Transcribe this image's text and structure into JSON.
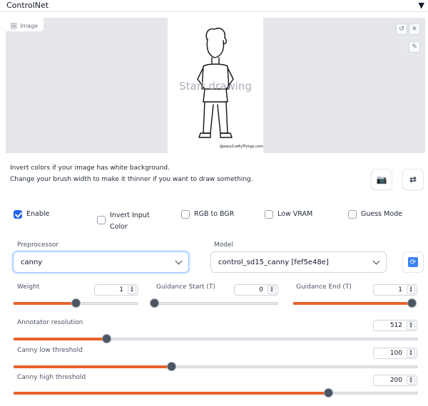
{
  "header": {
    "title": "ControlNet",
    "collapse_icon": "▼"
  },
  "canvas": {
    "image_tag": "Image",
    "placeholder": "Start drawing",
    "watermark": "@easyCraftyThings.com",
    "icons": [
      "undo-icon",
      "brush-icon"
    ]
  },
  "info": {
    "line1": "Invert colors if your image has white background.",
    "line2": "Change your brush width to make it thinner if you want to draw something.",
    "camera_icon": "📷",
    "swap_icon": "⇄"
  },
  "checkboxes": [
    {
      "label": "Enable",
      "checked": true
    },
    {
      "label": "Invert Input Color",
      "checked": false
    },
    {
      "label": "RGB to BGR",
      "checked": false
    },
    {
      "label": "Low VRAM",
      "checked": false
    },
    {
      "label": "Guess Mode",
      "checked": false
    }
  ],
  "preprocessor": {
    "label": "Preprocessor",
    "value": "canny"
  },
  "model": {
    "label": "Model",
    "value": "control_sd15_canny [fef5e48e]"
  },
  "sliders": {
    "weight": {
      "label": "Weight",
      "value": "1",
      "fraction": 0.5
    },
    "guidance_start": {
      "label": "Guidance Start (T)",
      "value": "0",
      "fraction": 0.0
    },
    "guidance_end": {
      "label": "Guidance End (T)",
      "value": "1",
      "fraction": 1.0
    },
    "annotator_resolution": {
      "label": "Annotator resolution",
      "value": "512",
      "fraction": 0.23
    },
    "canny_low": {
      "label": "Canny low threshold",
      "value": "100",
      "fraction": 0.39
    },
    "canny_high": {
      "label": "Canny high threshold",
      "value": "200",
      "fraction": 0.78
    }
  },
  "colors": {
    "accent": "#e8622a",
    "checkbox": "#2563eb"
  }
}
